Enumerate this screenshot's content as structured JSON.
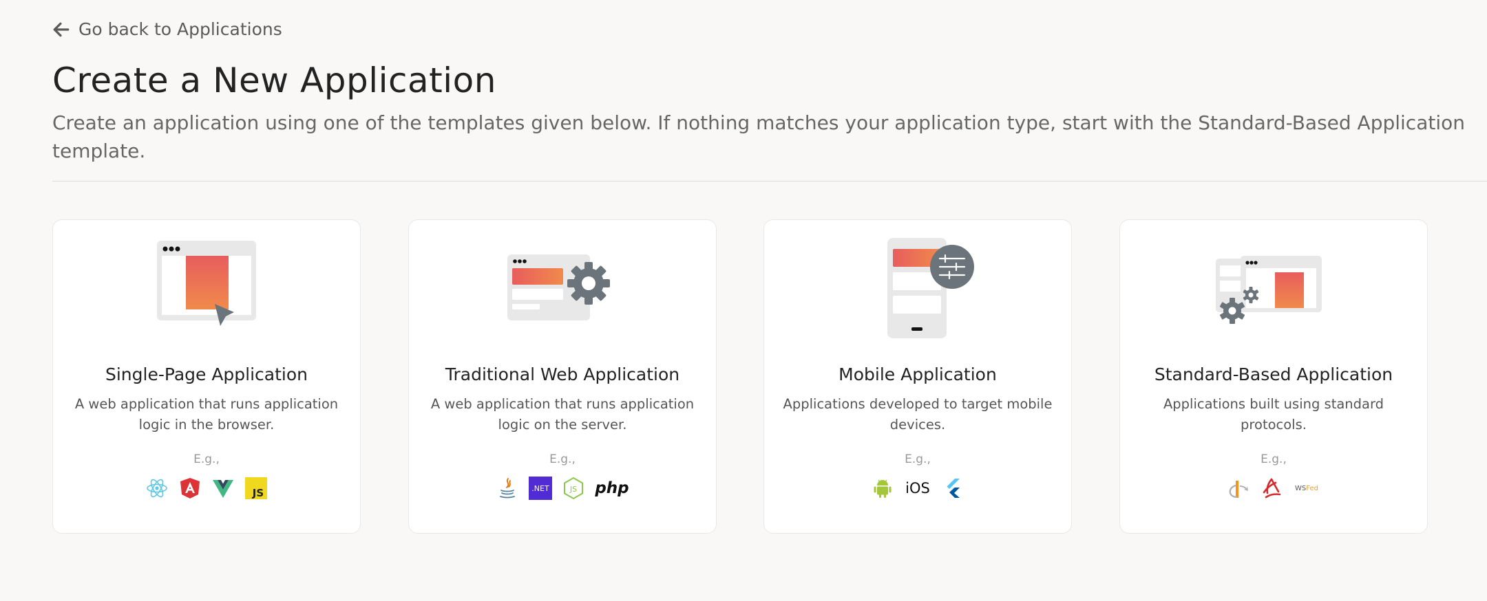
{
  "back": {
    "label": "Go back to Applications"
  },
  "page": {
    "title": "Create a New Application",
    "description": "Create an application using one of the templates given below. If nothing matches your application type, start with the Standard-Based Application template."
  },
  "cards": [
    {
      "title": "Single-Page Application",
      "description": "A web application that runs application logic in the browser.",
      "eg_label": "E.g.,",
      "techs": [
        "react-icon",
        "angular-icon",
        "vue-icon",
        "javascript-icon"
      ]
    },
    {
      "title": "Traditional Web Application",
      "description": "A web application that runs application logic on the server.",
      "eg_label": "E.g.,",
      "techs": [
        "java-icon",
        "dotnet-icon",
        "nodejs-icon",
        "php-icon"
      ],
      "dotnet_text": ".NET",
      "php_text": "php"
    },
    {
      "title": "Mobile Application",
      "description": "Applications developed to target mobile devices.",
      "eg_label": "E.g.,",
      "techs": [
        "android-icon",
        "ios-icon",
        "flutter-icon"
      ],
      "ios_text": "iOS"
    },
    {
      "title": "Standard-Based Application",
      "description": "Applications built using standard protocols.",
      "eg_label": "E.g.,",
      "techs": [
        "openid-icon",
        "saml-icon",
        "wsfed-icon"
      ],
      "wsfed_ws": "WS",
      "wsfed_fed": "Fed"
    }
  ],
  "colors": {
    "accent_gradient_start": "#ef5b5b",
    "accent_gradient_end": "#f08a4b",
    "illustration_gray": "#e8e8e8",
    "icon_dark": "#6a747a"
  }
}
